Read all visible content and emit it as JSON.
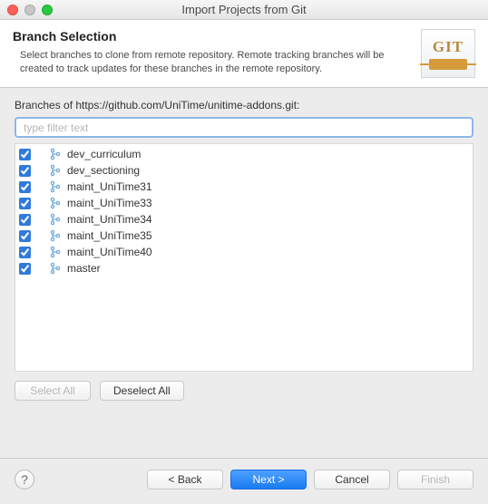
{
  "window": {
    "title": "Import Projects from Git"
  },
  "header": {
    "title": "Branch Selection",
    "desc": "Select branches to clone from remote repository. Remote tracking branches will be created to track updates for these branches in the remote repository.",
    "logo_text": "GIT"
  },
  "body": {
    "branches_label": "Branches of https://github.com/UniTime/unitime-addons.git:",
    "filter_placeholder": "type filter text"
  },
  "branches": [
    {
      "name": "dev_curriculum",
      "checked": true
    },
    {
      "name": "dev_sectioning",
      "checked": true
    },
    {
      "name": "maint_UniTime31",
      "checked": true
    },
    {
      "name": "maint_UniTime33",
      "checked": true
    },
    {
      "name": "maint_UniTime34",
      "checked": true
    },
    {
      "name": "maint_UniTime35",
      "checked": true
    },
    {
      "name": "maint_UniTime40",
      "checked": true
    },
    {
      "name": "master",
      "checked": true
    }
  ],
  "buttons": {
    "select_all": "Select All",
    "deselect_all": "Deselect All",
    "back": "< Back",
    "next": "Next >",
    "cancel": "Cancel",
    "finish": "Finish"
  },
  "state": {
    "select_all_enabled": false,
    "finish_enabled": false
  }
}
